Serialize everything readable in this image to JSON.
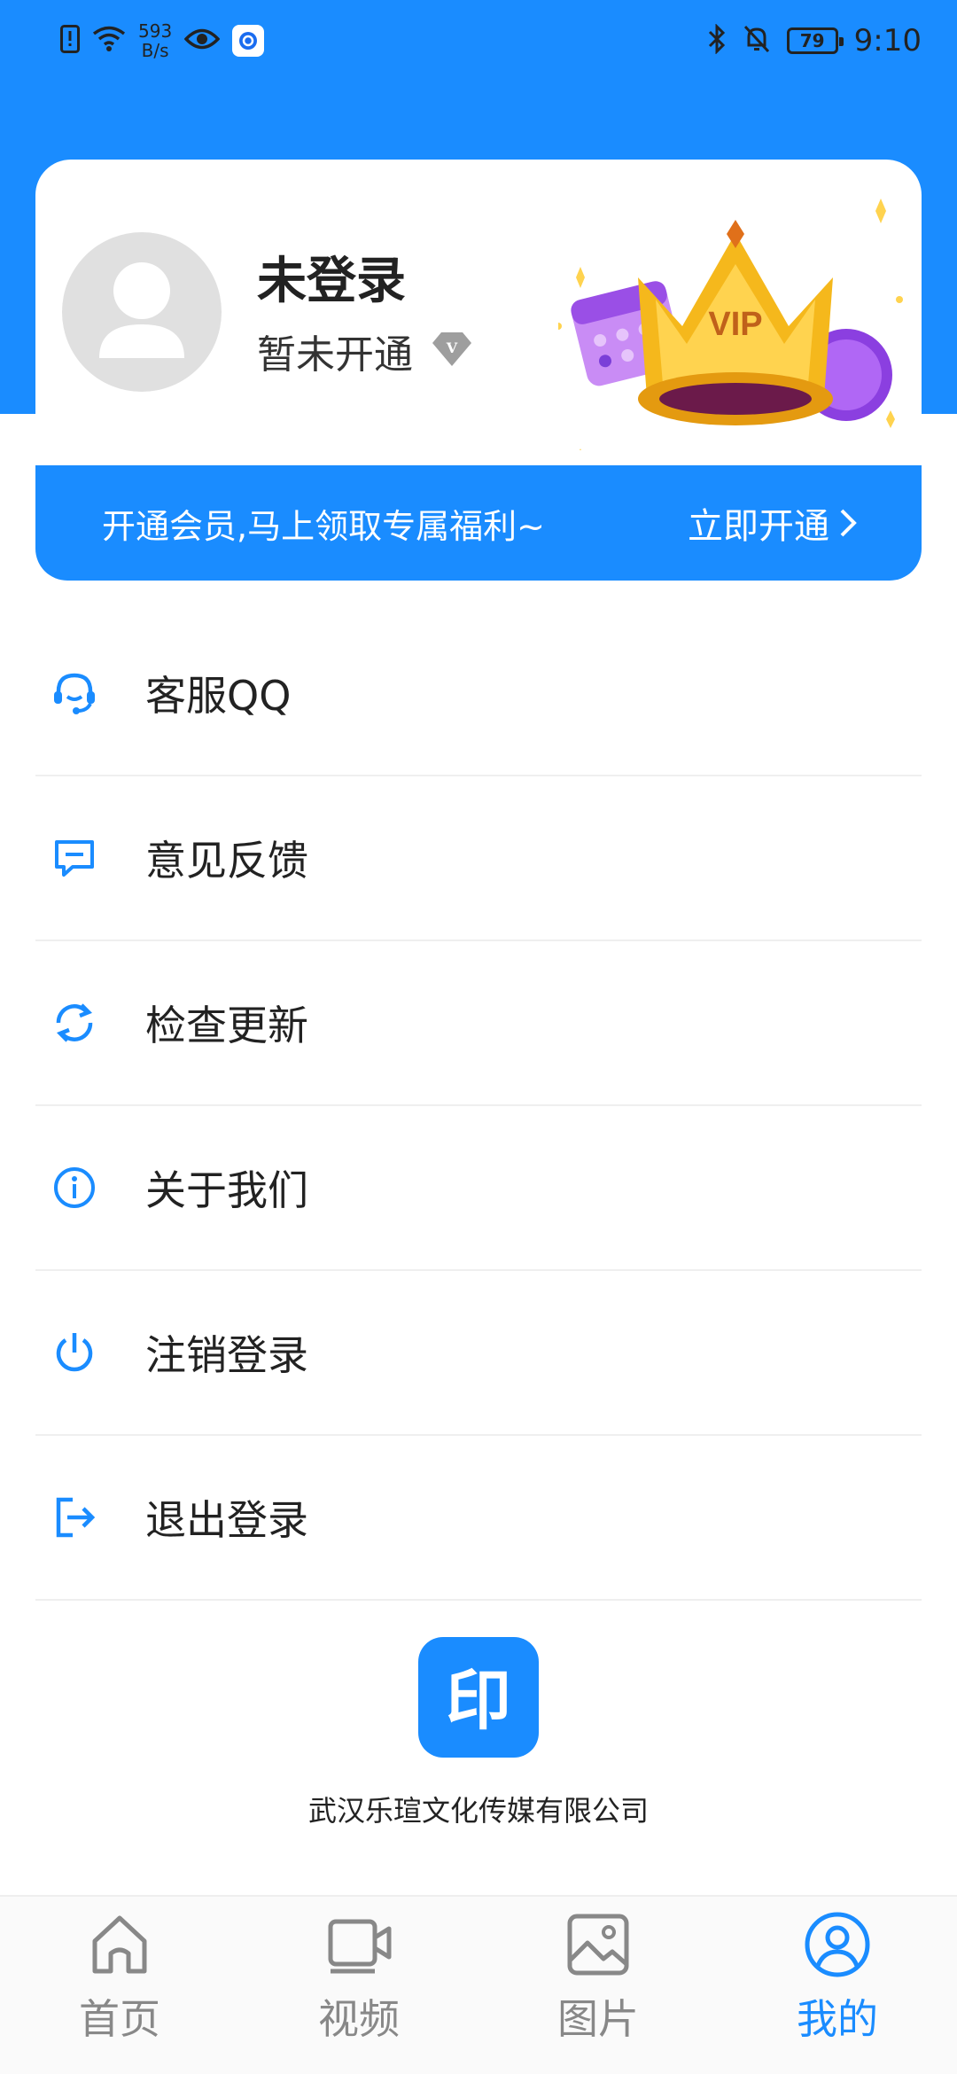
{
  "status_bar": {
    "speed_value": "593",
    "speed_unit": "B/s",
    "battery": "79",
    "time": "9:10"
  },
  "profile": {
    "username": "未登录",
    "vip_status": "暂未开通",
    "badge_text": "VIP"
  },
  "vip_banner": {
    "text": "开通会员,马上领取专属福利~",
    "action": "立即开通"
  },
  "menu": {
    "items": [
      {
        "label": "客服QQ",
        "icon": "headset-icon"
      },
      {
        "label": "意见反馈",
        "icon": "feedback-icon"
      },
      {
        "label": "检查更新",
        "icon": "refresh-icon"
      },
      {
        "label": "关于我们",
        "icon": "info-icon"
      },
      {
        "label": "注销登录",
        "icon": "power-icon"
      },
      {
        "label": "退出登录",
        "icon": "logout-icon"
      }
    ]
  },
  "company": {
    "logo_text": "印",
    "name": "武汉乐瑄文化传媒有限公司"
  },
  "bottom_nav": {
    "items": [
      {
        "label": "首页",
        "icon": "home-icon",
        "active": false
      },
      {
        "label": "视频",
        "icon": "video-icon",
        "active": false
      },
      {
        "label": "图片",
        "icon": "image-icon",
        "active": false
      },
      {
        "label": "我的",
        "icon": "user-icon",
        "active": true
      }
    ]
  },
  "colors": {
    "accent": "#1a8cff",
    "inactive": "#888888"
  }
}
